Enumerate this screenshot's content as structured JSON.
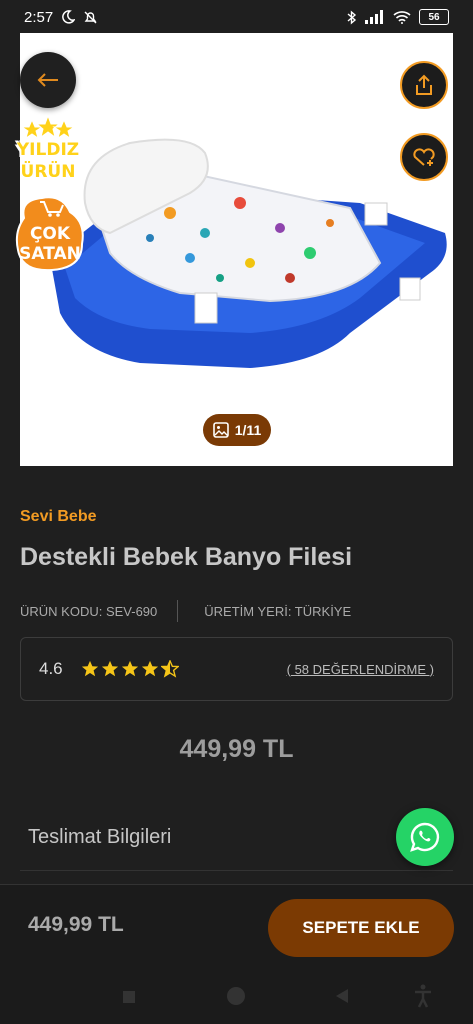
{
  "status": {
    "time": "2:57",
    "battery": "56"
  },
  "badges": {
    "star_badge": [
      "YILDIZ",
      "ÜRÜN"
    ],
    "sale_badge": [
      "ÇOK",
      "SATAN"
    ]
  },
  "gallery": {
    "counter": "1/11"
  },
  "product": {
    "brand": "Sevi Bebe",
    "title": "Destekli Bebek Banyo Filesi",
    "code_label": "ÜRÜN KODU: SEV-690",
    "origin_label": "ÜRETİM YERİ: TÜRKİYE",
    "rating": "4.6",
    "rating_value": 4.6,
    "reviews": "( 58 DEĞERLENDİRME )",
    "price": "449,99 TL"
  },
  "sections": {
    "delivery": "Teslimat Bilgileri"
  },
  "footer": {
    "price": "449,99 TL",
    "add_to_cart": "SEPETE EKLE"
  },
  "colors": {
    "accent": "#f29b23",
    "button": "#7b3a03",
    "background": "#1f1f1f",
    "whatsapp": "#25d366"
  }
}
